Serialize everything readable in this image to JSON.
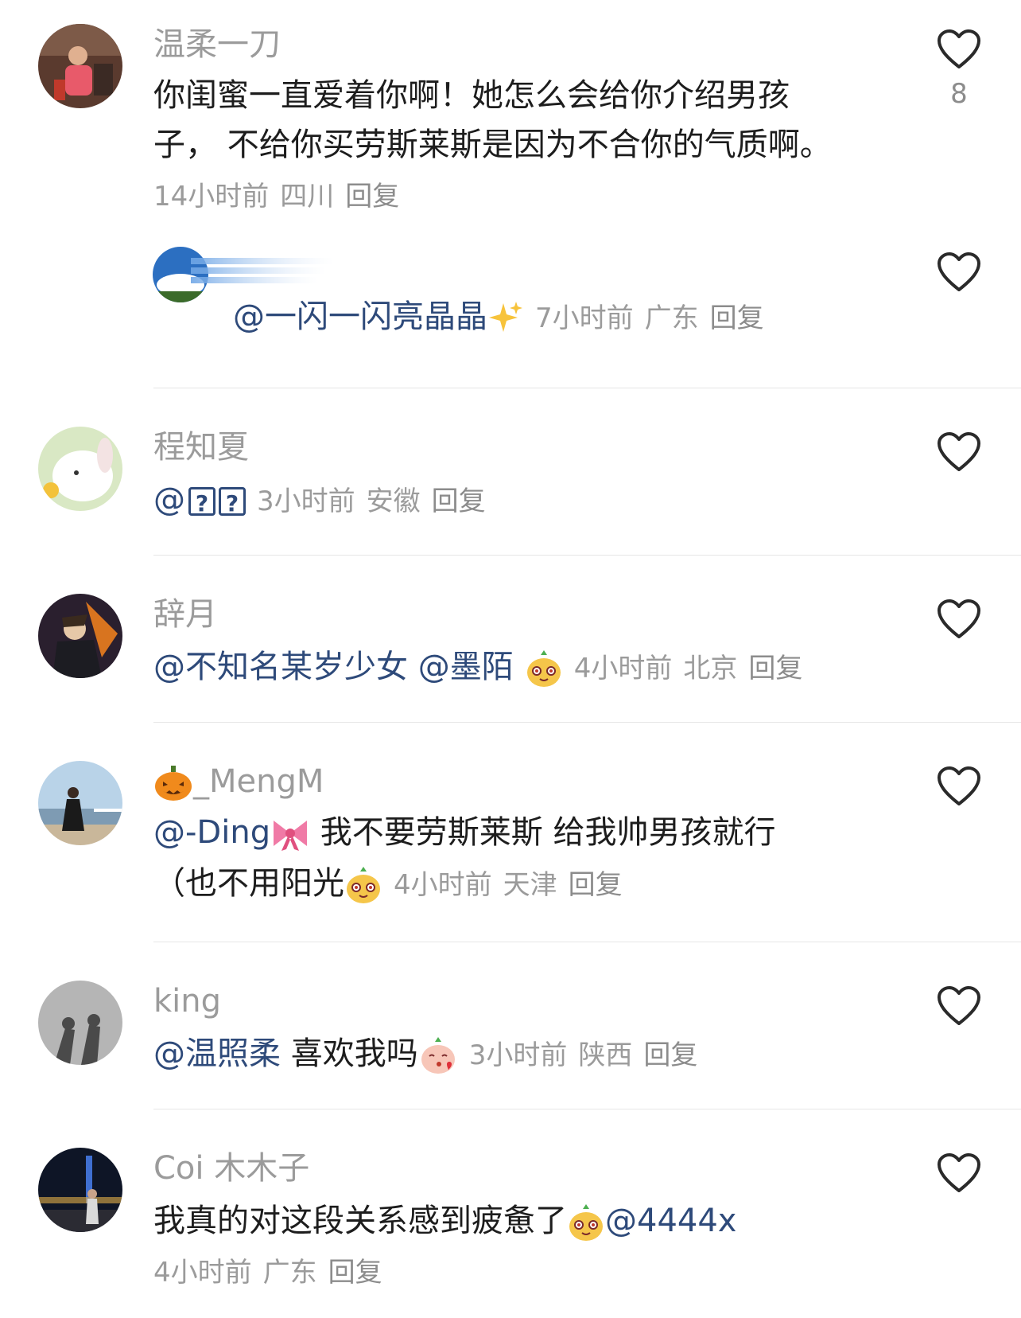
{
  "comments": [
    {
      "username": "温柔一刀",
      "text_line1": "你闺蜜一直爱着你啊！她怎么会给你介绍男孩",
      "text_line2": "子，  不给你买劳斯莱斯是因为不合你的气质啊。",
      "time": "14小时前",
      "location": "四川",
      "reply": "回复",
      "likes": "8"
    },
    {
      "mention": "@一闪一闪亮晶晶",
      "time": "7小时前",
      "location": "广东",
      "reply": "回复"
    },
    {
      "username": "程知夏",
      "mention": "@",
      "time": "3小时前",
      "location": "安徽",
      "reply": "回复"
    },
    {
      "username": "辞月",
      "mention": "@不知名某岁少女 @墨陌",
      "time": "4小时前",
      "location": "北京",
      "reply": "回复"
    },
    {
      "username": "_MengM",
      "mention": "@-Ding",
      "text_line1": " 我不要劳斯莱斯  给我帅男孩就行",
      "text_line2": "（也不用阳光",
      "time": "4小时前",
      "location": "天津",
      "reply": "回复"
    },
    {
      "username": "king",
      "mention": "@温照柔",
      "text": " 喜欢我吗",
      "time": "3小时前",
      "location": "陕西",
      "reply": "回复"
    },
    {
      "username": "Coi 木木子",
      "text": "我真的对这段关系感到疲惫了",
      "mention": "@4444x",
      "time": "4小时前",
      "location": "广东",
      "reply": "回复"
    }
  ],
  "icons": {
    "like": "heart-outline-icon"
  },
  "colors": {
    "mention": "#2e4a7a",
    "meta": "#9b9b9b",
    "text": "#1d1d1d"
  }
}
